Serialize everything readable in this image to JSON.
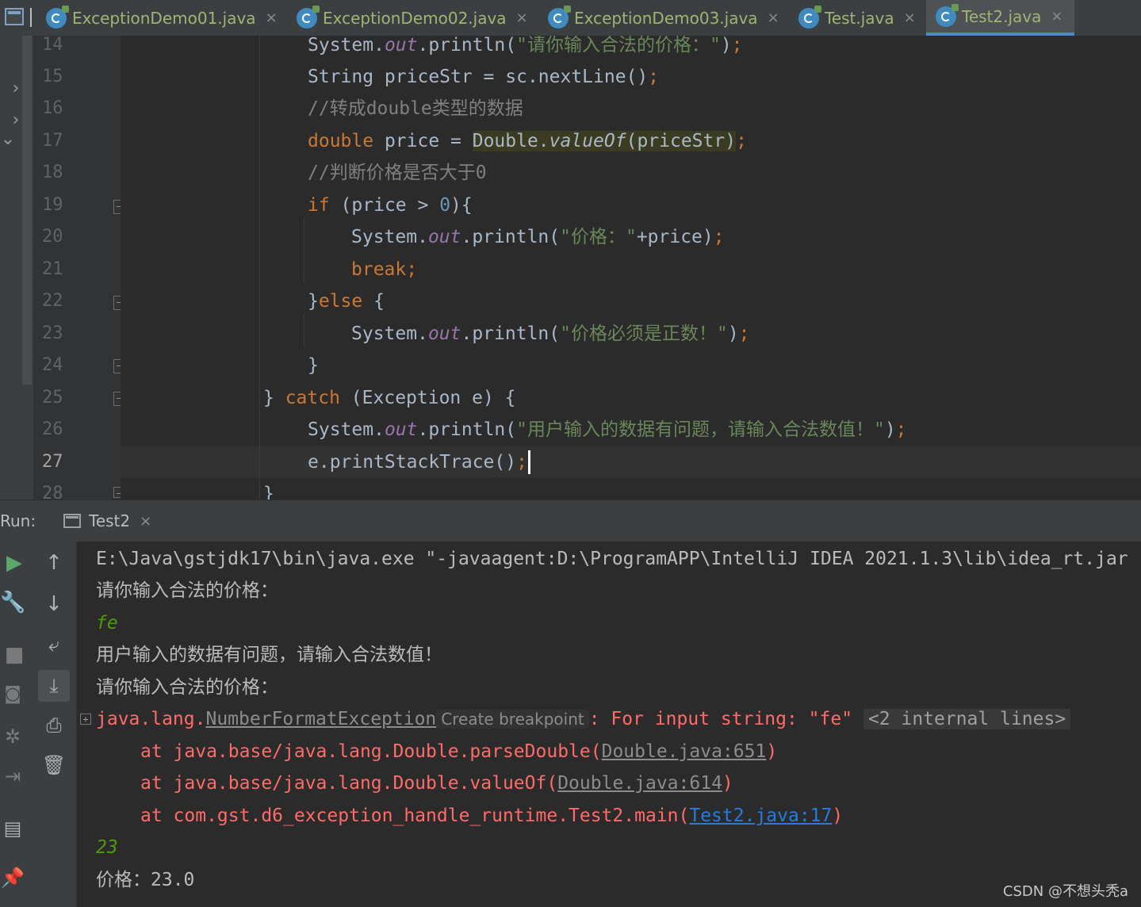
{
  "tabs": [
    {
      "label": "ExceptionDemo01.java",
      "active": false
    },
    {
      "label": "ExceptionDemo02.java",
      "active": false
    },
    {
      "label": "ExceptionDemo03.java",
      "active": false
    },
    {
      "label": "Test.java",
      "active": false
    },
    {
      "label": "Test2.java",
      "active": true
    }
  ],
  "tab_close_glyph": "×",
  "editor": {
    "line_numbers": [
      "14",
      "15",
      "16",
      "17",
      "18",
      "19",
      "20",
      "21",
      "22",
      "23",
      "24",
      "25",
      "26",
      "27",
      "28"
    ],
    "current_line": "27",
    "code": {
      "l14_a": "System.",
      "l14_b": "out",
      "l14_c": ".println(",
      "l14_d": "\"请你输入合法的价格：\"",
      "l14_e": ")",
      "l14_f": ";",
      "l15_a": "String priceStr = sc.nextLine()",
      "l15_b": ";",
      "l16": "//转成double类型的数据",
      "l17_a": "double",
      "l17_b": " price = ",
      "l17_c": "Double.",
      "l17_d": "valueOf",
      "l17_e": "(priceStr)",
      "l17_f": ";",
      "l18": "//判断价格是否大于0",
      "l19_a": "if",
      "l19_b": " (price > ",
      "l19_c": "0",
      "l19_d": "){",
      "l20_a": "System.",
      "l20_b": "out",
      "l20_c": ".println(",
      "l20_d": "\"价格：\"",
      "l20_e": "+price)",
      "l20_f": ";",
      "l21": "break;",
      "l22_a": "}",
      "l22_b": "else",
      "l22_c": " {",
      "l23_a": "System.",
      "l23_b": "out",
      "l23_c": ".println(",
      "l23_d": "\"价格必须是正数！\"",
      "l23_e": ")",
      "l23_f": ";",
      "l24": "}",
      "l25_a": "} ",
      "l25_b": "catch",
      "l25_c": " (Exception e) {",
      "l26_a": "System.",
      "l26_b": "out",
      "l26_c": ".println(",
      "l26_d": "\"用户输入的数据有问题，请输入合法数值！\"",
      "l26_e": ")",
      "l26_f": ";",
      "l27_a": "e.printStackTrace()",
      "l27_b": ";",
      "l28": "}"
    }
  },
  "run_panel": {
    "label": "Run:",
    "tab": "Test2",
    "console": {
      "cmd": "E:\\Java\\gstjdk17\\bin\\java.exe \"-javaagent:D:\\ProgramAPP\\IntelliJ IDEA 2021.1.3\\lib\\idea_rt.jar",
      "prompt1": "请你输入合法的价格：",
      "input1": "fe",
      "error_msg": "用户输入的数据有问题，请输入合法数值！",
      "prompt2": "请你输入合法的价格：",
      "exc_pkg": "java.lang.",
      "exc_name": "NumberFormatException",
      "tooltip": "Create breakpoint",
      "exc_msg": ": For input string: \"fe\"",
      "internal": "<2 internal lines>",
      "st1_a": "at java.base/java.lang.Double.parseDouble(",
      "st1_link": "Double.java:651",
      "st1_b": ")",
      "st2_a": "at java.base/java.lang.Double.valueOf(",
      "st2_link": "Double.java:614",
      "st2_b": ")",
      "st3_a": "at com.gst.d6_exception_handle_runtime.Test2.main(",
      "st3_link": "Test2.java:17",
      "st3_b": ")",
      "input2": "23",
      "result": "价格：23.0"
    }
  },
  "watermark": "CSDN @不想头秃a"
}
